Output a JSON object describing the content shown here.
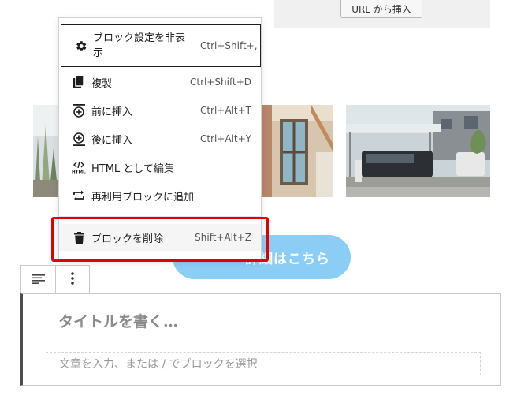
{
  "url_panel": {
    "button_label": "URL から挿入"
  },
  "cta": {
    "label": "詳細はこちら"
  },
  "menu": {
    "items": [
      {
        "label": "ブロック設定を非表示",
        "shortcut": "Ctrl+Shift+,",
        "icon": "gear-icon"
      },
      {
        "label": "複製",
        "shortcut": "Ctrl+Shift+D",
        "icon": "duplicate-icon"
      },
      {
        "label": "前に挿入",
        "shortcut": "Ctrl+Alt+T",
        "icon": "insert-before-icon"
      },
      {
        "label": "後に挿入",
        "shortcut": "Ctrl+Alt+Y",
        "icon": "insert-after-icon"
      },
      {
        "label": "HTML として編集",
        "shortcut": "",
        "icon": "html-icon"
      },
      {
        "label": "再利用ブロックに追加",
        "shortcut": "",
        "icon": "reusable-block-icon"
      },
      {
        "label": "ブロックを削除",
        "shortcut": "Shift+Alt+Z",
        "icon": "trash-icon"
      }
    ]
  },
  "editor": {
    "title_placeholder": "タイトルを書く…",
    "paragraph_placeholder": "文章を入力、または / でブロックを選択"
  },
  "colors": {
    "highlight": "#e00000",
    "cta": "#8ccdf5"
  }
}
